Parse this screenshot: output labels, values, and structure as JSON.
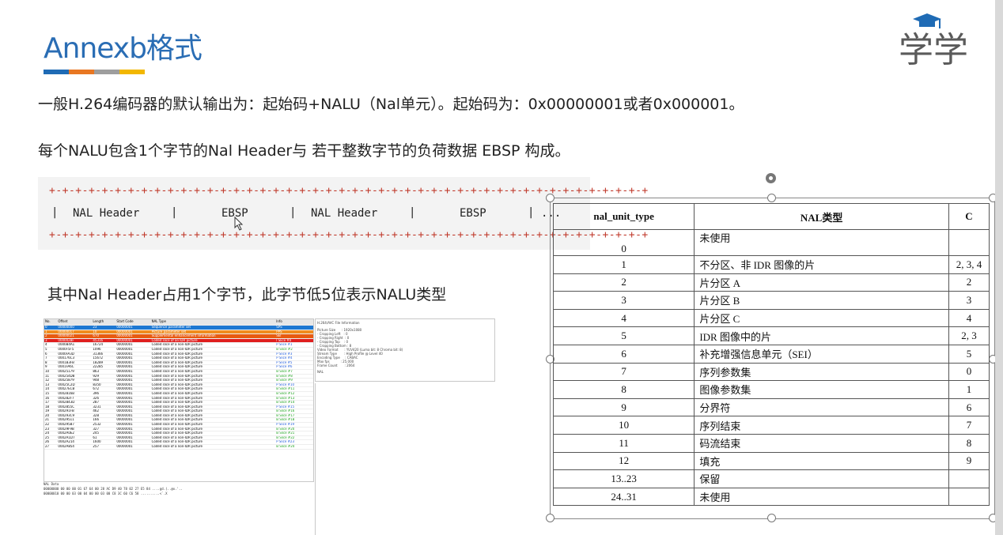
{
  "title": "Annexb格式",
  "stripe_colors": [
    "#1f6bb5",
    "#e87722",
    "#9e9e9e",
    "#f2b700"
  ],
  "logo": {
    "text": "学学",
    "icon": "graduation-cap-icon",
    "color": "#5a5a5a",
    "cap_color": "#1f6bb5"
  },
  "text_line_1": "一般H.264编码器的默认输出为：起始码+NALU（Nal单元）。起始码为：0x00000001或者0x000001。",
  "text_line_2": "每个NALU包含1个字节的Nal Header与 若干整数字节的负荷数据 EBSP 构成。",
  "structure": {
    "border_line": "+-+-+-+-+-+-+-+-+-+-+-+-+-+-+-+-+-+-+-+-+-+-+-+-+-+-+-+-+-+-+-+-+-+-+-+-+-+-+-+-+-+-+-+-+-+",
    "cells": [
      "NAL Header",
      "EBSP",
      "NAL Header",
      "EBSP"
    ],
    "separator": "|",
    "trailing": "..."
  },
  "text_line_3": "其中Nal Header占用1个字节，此字节低5位表示NALU类型",
  "analyzer": {
    "columns": [
      "No.",
      "Offset",
      "Length",
      "Start Code",
      "NAL Type",
      "Info"
    ],
    "rows": [
      [
        "0",
        "00000000",
        "23",
        "00000001",
        "Sequence parameter set",
        "SPS"
      ],
      [
        "1",
        "00000017",
        "10",
        "00000001",
        "Picture parameter set",
        "PPS"
      ],
      [
        "2",
        "00000021",
        "670",
        "00000001",
        "Supplemental enhancement information",
        "SEI"
      ],
      [
        "3",
        "000002BF",
        "45316",
        "00000001",
        "Coded slice of an IDR picture",
        "I Slice #0"
      ],
      [
        "4",
        "0000B4A1",
        "16724",
        "00000001",
        "Coded slice of a non-IDR picture",
        "P Slice #1"
      ],
      [
        "5",
        "0000F5F5",
        "1096",
        "00000001",
        "Coded slice of a non-IDR picture",
        "B Slice #2"
      ],
      [
        "6",
        "0000FA3D",
        "31366",
        "00000001",
        "Coded slice of a non-IDR picture",
        "P Slice #3"
      ],
      [
        "7",
        "000176C3",
        "15672",
        "00000001",
        "Coded slice of a non-IDR picture",
        "P Slice #4"
      ],
      [
        "8",
        "0001B3FB",
        "18289",
        "00000001",
        "Coded slice of a non-IDR picture",
        "P Slice #5"
      ],
      [
        "9",
        "0001FA6C",
        "22285",
        "00000001",
        "Coded slice of a non-IDR picture",
        "P Slice #6"
      ],
      [
        "10",
        "00025179",
        "863",
        "00000001",
        "Coded slice of a non-IDR picture",
        "B Slice #7"
      ],
      [
        "11",
        "000254D8",
        "929",
        "00000001",
        "Coded slice of a non-IDR picture",
        "B Slice #8"
      ],
      [
        "12",
        "00025879",
        "948",
        "00000001",
        "Coded slice of a non-IDR picture",
        "B Slice #9"
      ],
      [
        "13",
        "00025C2D",
        "8350",
        "00000001",
        "Coded slice of a non-IDR picture",
        "P Slice #10"
      ],
      [
        "14",
        "00027ECB",
        "672",
        "00000001",
        "Coded slice of a non-IDR picture",
        "B Slice #11"
      ],
      [
        "15",
        "0002816B",
        "396",
        "00000001",
        "Coded slice of a non-IDR picture",
        "B Slice #12"
      ],
      [
        "16",
        "000282F7",
        "326",
        "00000001",
        "Coded slice of a non-IDR picture",
        "B Slice #13"
      ],
      [
        "17",
        "0002843D",
        "287",
        "00000001",
        "Coded slice of a non-IDR picture",
        "B Slice #14"
      ],
      [
        "18",
        "0002855C",
        "3231",
        "00000001",
        "Coded slice of a non-IDR picture",
        "P Slice #15"
      ],
      [
        "19",
        "000291FB",
        "462",
        "00000001",
        "Coded slice of a non-IDR picture",
        "B Slice #16"
      ],
      [
        "20",
        "000293C9",
        "328",
        "00000001",
        "Coded slice of a non-IDR picture",
        "B Slice #17"
      ],
      [
        "21",
        "00029511",
        "166",
        "00000001",
        "Coded slice of a non-IDR picture",
        "B Slice #18"
      ],
      [
        "22",
        "000295B7",
        "2532",
        "00000001",
        "Coded slice of a non-IDR picture",
        "P Slice #19"
      ],
      [
        "23",
        "00029F9B",
        "327",
        "00000001",
        "Coded slice of a non-IDR picture",
        "B Slice #20"
      ],
      [
        "24",
        "0002A0E2",
        "245",
        "00000001",
        "Coded slice of a non-IDR picture",
        "B Slice #21"
      ],
      [
        "25",
        "0002A1D7",
        "61",
        "00000001",
        "Coded slice of a non-IDR picture",
        "B Slice #22"
      ],
      [
        "26",
        "0002A214",
        "1600",
        "00000001",
        "Coded slice of a non-IDR picture",
        "P Slice #23"
      ],
      [
        "27",
        "0002A854",
        "257",
        "00000001",
        "Coded slice of a non-IDR picture",
        "B Slice #24"
      ]
    ],
    "row_colors": [
      "#1e78d2",
      "#f08c1e",
      "#e85a10",
      "#e01e1e"
    ],
    "hex_label": "NAL Data",
    "hex_lines": [
      "00000000 00 00 00 01 67 64 00 28 AC D9 40 78 02 27 E5 84  ....gd.(..@x.'..",
      "00000010 00 00 03 00 04 00 00 03 00 C8 3C 60 C6 58         ..........<`.X"
    ]
  },
  "file_info": {
    "title": "H.264/AVC File Information",
    "lines": [
      "Picture Size      : 1920x1080",
      "- Cropping Left   : 0",
      "- Cropping Right  : 0",
      "- Cropping Top    : 0",
      "- Cropping Bottom : 8",
      "Video Format      : YUV420 (Luma bit: 8 Chroma bit: 8)",
      "Stream Type       : High Profile @ Level 40",
      "Encoding Type     : CABAC",
      "Max fps           : 25.000",
      "Frame Count       : 2064"
    ],
    "tree_label": "NAL"
  },
  "nal_table": {
    "headers": [
      "nal_unit_type",
      "NAL类型",
      "C"
    ],
    "rows": [
      [
        "0",
        "未使用",
        ""
      ],
      [
        "1",
        "不分区、非 IDR 图像的片",
        "2, 3, 4"
      ],
      [
        "2",
        "片分区 A",
        "2"
      ],
      [
        "3",
        "片分区 B",
        "3"
      ],
      [
        "4",
        "片分区 C",
        "4"
      ],
      [
        "5",
        "IDR 图像中的片",
        "2, 3"
      ],
      [
        "6",
        "补充增强信息单元（SEI）",
        "5"
      ],
      [
        "7",
        "序列参数集",
        "0"
      ],
      [
        "8",
        "图像参数集",
        "1"
      ],
      [
        "9",
        "分界符",
        "6"
      ],
      [
        "10",
        "序列结束",
        "7"
      ],
      [
        "11",
        "码流结束",
        "8"
      ],
      [
        "12",
        "填充",
        "9"
      ],
      [
        "13..23",
        "保留",
        ""
      ],
      [
        "24..31",
        "未使用",
        ""
      ]
    ]
  }
}
